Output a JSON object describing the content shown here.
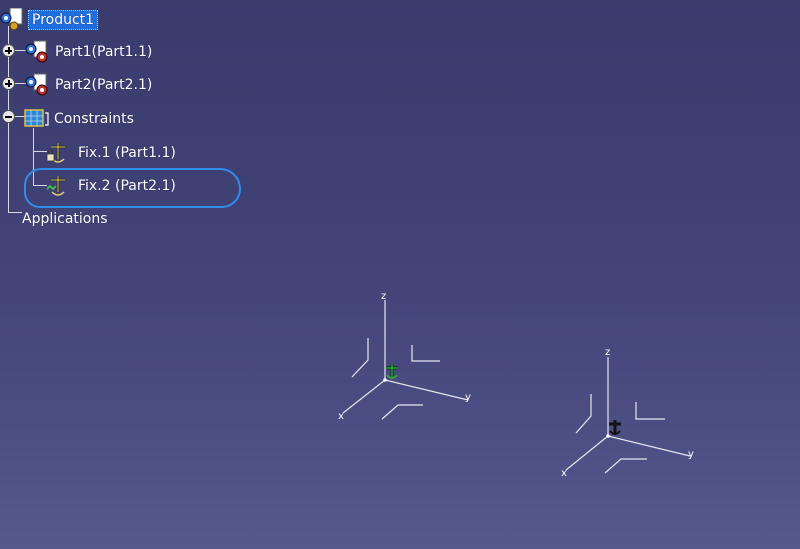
{
  "tree": {
    "root_label": "Product1",
    "part1_label": "Part1(Part1.1)",
    "part2_label": "Part2(Part2.1)",
    "constraints_label": "Constraints",
    "fix1_label": "Fix.1 (Part1.1)",
    "fix2_label": "Fix.2 (Part2.1)",
    "applications_label": "Applications"
  },
  "icons": {
    "root": "product-icon",
    "part": "part-icon",
    "constraints": "constraints-icon",
    "fix": "fix-constraint-icon"
  },
  "axes": [
    {
      "name": "axis-system-1",
      "z": "z",
      "y": "y",
      "x": "x",
      "anchor_color": "#2fae3a"
    },
    {
      "name": "axis-system-2",
      "z": "z",
      "y": "y",
      "x": "x",
      "anchor_color": "#111111"
    }
  ],
  "colors": {
    "selection": "#1e6ee0",
    "annotation_stroke": "#2f8fe8"
  }
}
